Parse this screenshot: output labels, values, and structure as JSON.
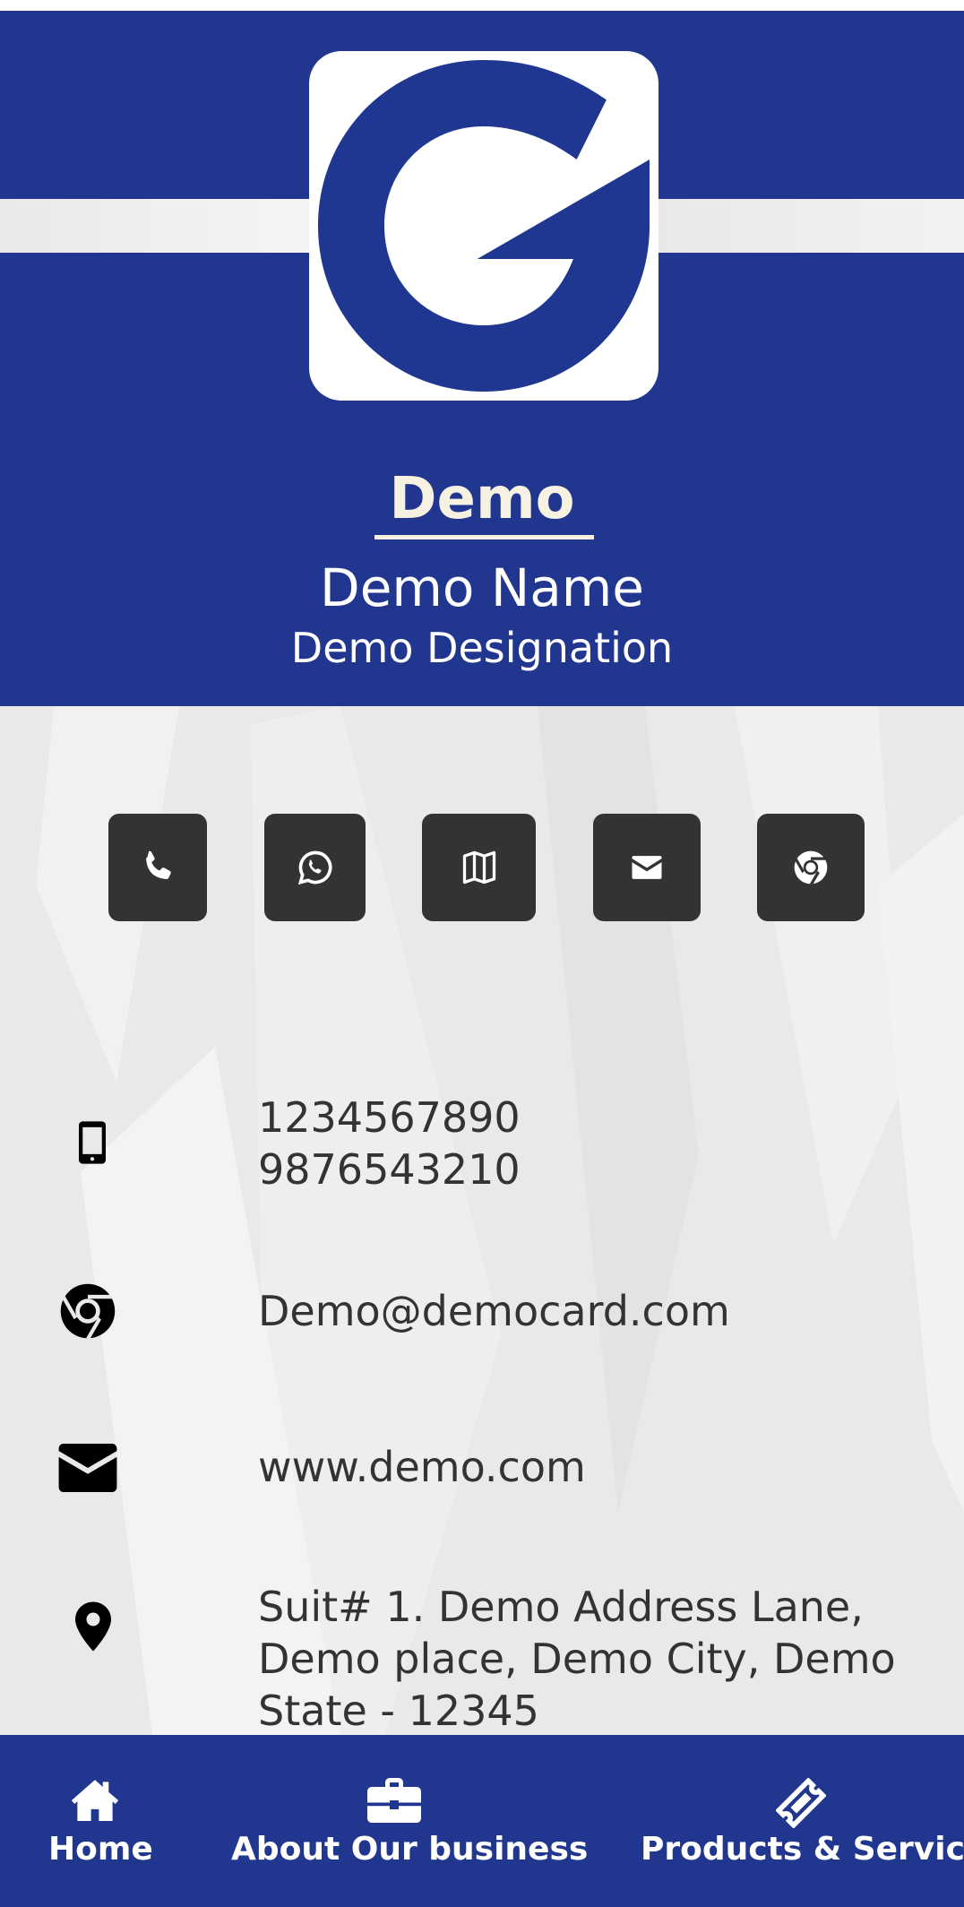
{
  "header": {
    "company": "Demo",
    "person_name": "Demo Name",
    "designation": "Demo Designation"
  },
  "actions": [
    {
      "name": "call-button",
      "icon": "phone-icon"
    },
    {
      "name": "whatsapp-button",
      "icon": "whatsapp-icon"
    },
    {
      "name": "map-button",
      "icon": "map-icon"
    },
    {
      "name": "email-button",
      "icon": "envelope-icon"
    },
    {
      "name": "website-button",
      "icon": "chrome-icon"
    }
  ],
  "contact": {
    "phones": [
      "1234567890",
      "9876543210"
    ],
    "email": "Demo@democard.com",
    "website": "www.demo.com",
    "address_lines": [
      "Suit# 1. Demo Address Lane,",
      "Demo place, Demo City, Demo",
      "State - 12345"
    ]
  },
  "nav": [
    {
      "label": "Home",
      "icon": "home-icon"
    },
    {
      "label": "About Our business",
      "icon": "briefcase-icon"
    },
    {
      "label": "Products & Services",
      "icon": "ticket-icon"
    }
  ],
  "colors": {
    "brand_blue": "#21378f",
    "button_dark": "#333333",
    "company_text": "#f7f1e1"
  }
}
